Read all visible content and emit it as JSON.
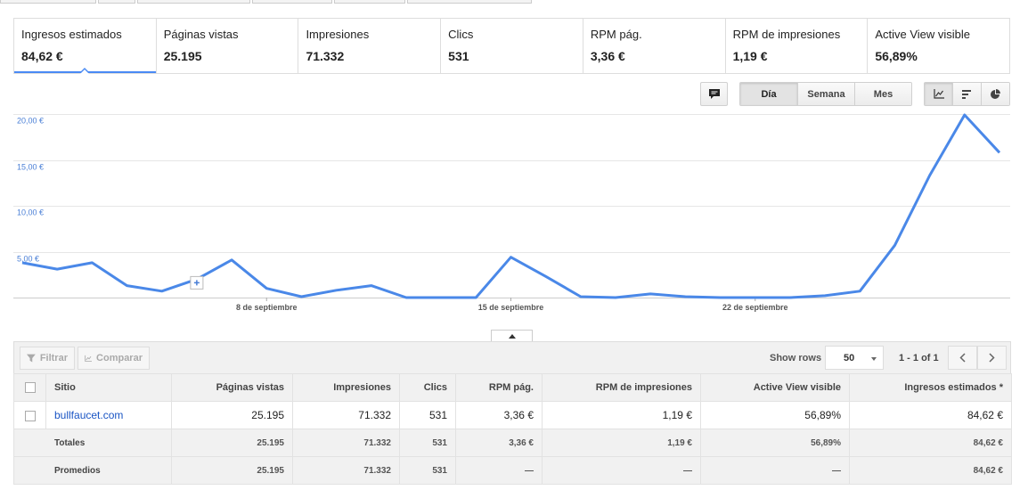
{
  "metrics": [
    {
      "label": "Ingresos estimados",
      "value": "84,62 €",
      "active": true
    },
    {
      "label": "Páginas vistas",
      "value": "25.195"
    },
    {
      "label": "Impresiones",
      "value": "71.332"
    },
    {
      "label": "Clics",
      "value": "531"
    },
    {
      "label": "RPM pág.",
      "value": "3,36 €"
    },
    {
      "label": "RPM de impresiones",
      "value": "1,19 €"
    },
    {
      "label": "Active View visible",
      "value": "56,89%"
    }
  ],
  "chart_toolbar": {
    "comment_icon": "speech-bubble-icon",
    "periods": [
      "Día",
      "Semana",
      "Mes"
    ],
    "selected_period": "Día",
    "view_icons": [
      "line-chart-icon",
      "bar-chart-icon",
      "pie-chart-icon"
    ],
    "selected_view": "line-chart-icon"
  },
  "chart_data": {
    "type": "line",
    "ytick_labels": [
      "20,00 €",
      "15,00 €",
      "10,00 €",
      "5,00 €"
    ],
    "yticks": [
      20,
      15,
      10,
      5
    ],
    "ylim": [
      0,
      20
    ],
    "x_tick_labels": [
      {
        "index": 7,
        "label": "8 de septiembre"
      },
      {
        "index": 14,
        "label": "15 de septiembre"
      },
      {
        "index": 21,
        "label": "22 de septiembre"
      }
    ],
    "grid": true,
    "line_color": "#4a88e8",
    "series": [
      {
        "values": [
          3.8,
          3.1,
          3.8,
          1.3,
          0.7,
          2.0,
          4.1,
          1.0,
          0.1,
          0.8,
          1.3,
          0.0,
          0.0,
          0.0,
          4.4,
          2.3,
          0.1,
          0.0,
          0.4,
          0.1,
          0.0,
          0.0,
          0.0,
          0.2,
          0.7,
          5.7,
          13.3,
          19.9,
          15.8
        ]
      }
    ]
  },
  "table_toolbar": {
    "filter_label": "Filtrar",
    "compare_label": "Comparar",
    "show_rows_label": "Show rows",
    "rows_value": "50",
    "pager_text": "1 - 1 of 1"
  },
  "table": {
    "headers": [
      "Sitio",
      "Páginas vistas",
      "Impresiones",
      "Clics",
      "RPM pág.",
      "RPM de impresiones",
      "Active View visible",
      "Ingresos estimados *"
    ],
    "rows": [
      [
        "bullfaucet.com",
        "25.195",
        "71.332",
        "531",
        "3,36 €",
        "1,19 €",
        "56,89%",
        "84,62 €"
      ]
    ],
    "totals": [
      "Totales",
      "25.195",
      "71.332",
      "531",
      "3,36 €",
      "1,19 €",
      "56,89%",
      "84,62 €"
    ],
    "averages": [
      "Promedios",
      "25.195",
      "71.332",
      "531",
      "—",
      "—",
      "—",
      "84,62 €"
    ]
  }
}
